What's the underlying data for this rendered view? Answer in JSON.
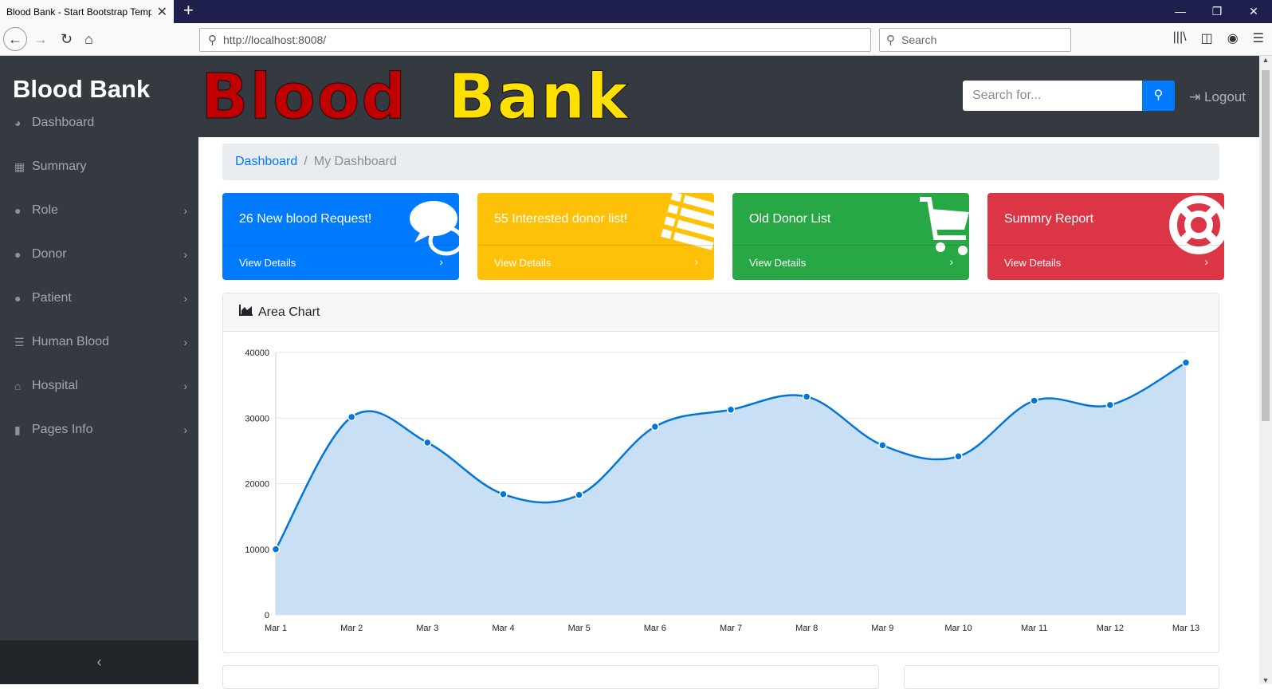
{
  "browser": {
    "tab_title": "Blood Bank - Start Bootstrap Templ",
    "url": "http://localhost:8008/",
    "search_placeholder": "Search"
  },
  "sidebar": {
    "brand": "Blood Bank",
    "items": [
      {
        "label": "Dashboard",
        "icon": "dashboard-icon"
      },
      {
        "label": "Summary",
        "icon": "table-icon"
      },
      {
        "label": "Role",
        "icon": "user-icon"
      },
      {
        "label": "Donor",
        "icon": "user-icon"
      },
      {
        "label": "Patient",
        "icon": "user-icon"
      },
      {
        "label": "Human Blood",
        "icon": "list-icon"
      },
      {
        "label": "Hospital",
        "icon": "home-icon"
      },
      {
        "label": "Pages Info",
        "icon": "file-icon"
      }
    ]
  },
  "header": {
    "logo_word1": "Blood",
    "logo_word2": "Bank",
    "search_placeholder": "Search for...",
    "logout_label": "Logout"
  },
  "breadcrumb": {
    "link": "Dashboard",
    "sep": "/",
    "active": "My Dashboard"
  },
  "cards": [
    {
      "text": "26 New blood Request!",
      "link": "View Details",
      "color": "#007bff"
    },
    {
      "text": "55 Interested donor list!",
      "link": "View Details",
      "color": "#ffc107"
    },
    {
      "text": "Old Donor List",
      "link": "View Details",
      "color": "#28a745"
    },
    {
      "text": "Summry Report",
      "link": "View Details",
      "color": "#dc3545"
    }
  ],
  "chart_card": {
    "title": "Area Chart"
  },
  "chart_data": {
    "type": "area",
    "categories": [
      "Mar 1",
      "Mar 2",
      "Mar 3",
      "Mar 4",
      "Mar 5",
      "Mar 6",
      "Mar 7",
      "Mar 8",
      "Mar 9",
      "Mar 10",
      "Mar 11",
      "Mar 12",
      "Mar 13"
    ],
    "values": [
      10000,
      30162,
      26263,
      18394,
      18287,
      28682,
      31274,
      33259,
      25849,
      24159,
      32651,
      31984,
      38451
    ],
    "ylim": [
      0,
      40000
    ],
    "yticks": [
      0,
      10000,
      20000,
      30000,
      40000
    ],
    "grid": true,
    "line_color": "#0275d8",
    "fill_color": "#c9dff5"
  }
}
